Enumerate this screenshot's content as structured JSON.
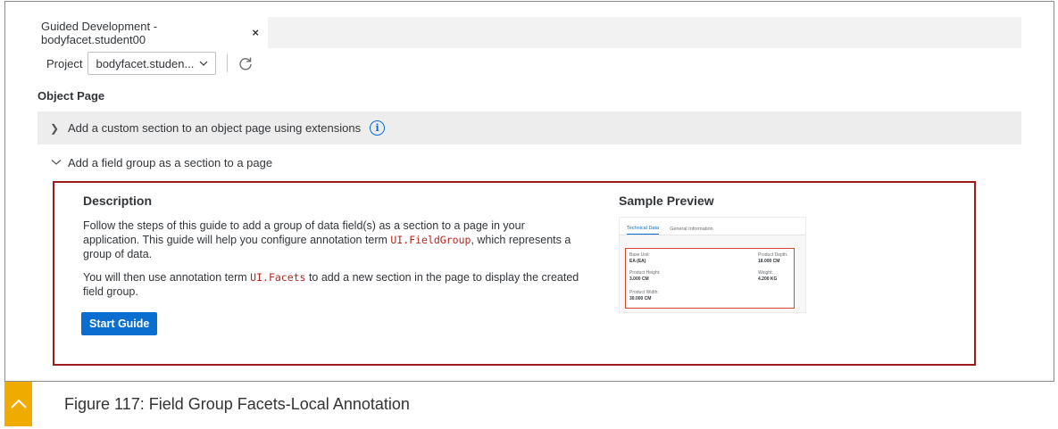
{
  "tab": {
    "title": "Guided Development - bodyfacet.student00",
    "close": "×"
  },
  "project": {
    "label": "Project",
    "value": "bodyfacet.studen..."
  },
  "section_title": "Object Page",
  "guides": [
    {
      "label": "Add a custom section to an object page using extensions",
      "expanded": false
    },
    {
      "label": "Add a field group as a section to a page",
      "expanded": true
    }
  ],
  "description": {
    "heading": "Description",
    "p1_a": "Follow the steps of this guide to add a group of data field(s) as a section to a page in your application. This guide will help you configure annotation term ",
    "p1_code": "UI.FieldGroup",
    "p1_b": ", which represents a group of data.",
    "p2_a": "You will then use annotation term ",
    "p2_code": "UI.Facets",
    "p2_b": " to add a new section in the page to display the created field group.",
    "start_button": "Start Guide"
  },
  "preview": {
    "heading": "Sample Preview",
    "tabs": [
      "Technical Data",
      "General Information"
    ],
    "fields": [
      {
        "label": "Base Unit:",
        "value": "EA (EA)"
      },
      {
        "label": "Product Depth:",
        "value": "18.000 CM"
      },
      {
        "label": "Product Height:",
        "value": "3.000 CM"
      },
      {
        "label": "Weight:",
        "value": "4.200 KG"
      },
      {
        "label": "Product Width:",
        "value": "30.000 CM"
      }
    ]
  },
  "caption": "Figure 117: Field Group Facets-Local Annotation",
  "colors": {
    "accent": "#0a6ed1",
    "highlight_border": "#9e1b1b",
    "badge": "#f0ab00"
  }
}
